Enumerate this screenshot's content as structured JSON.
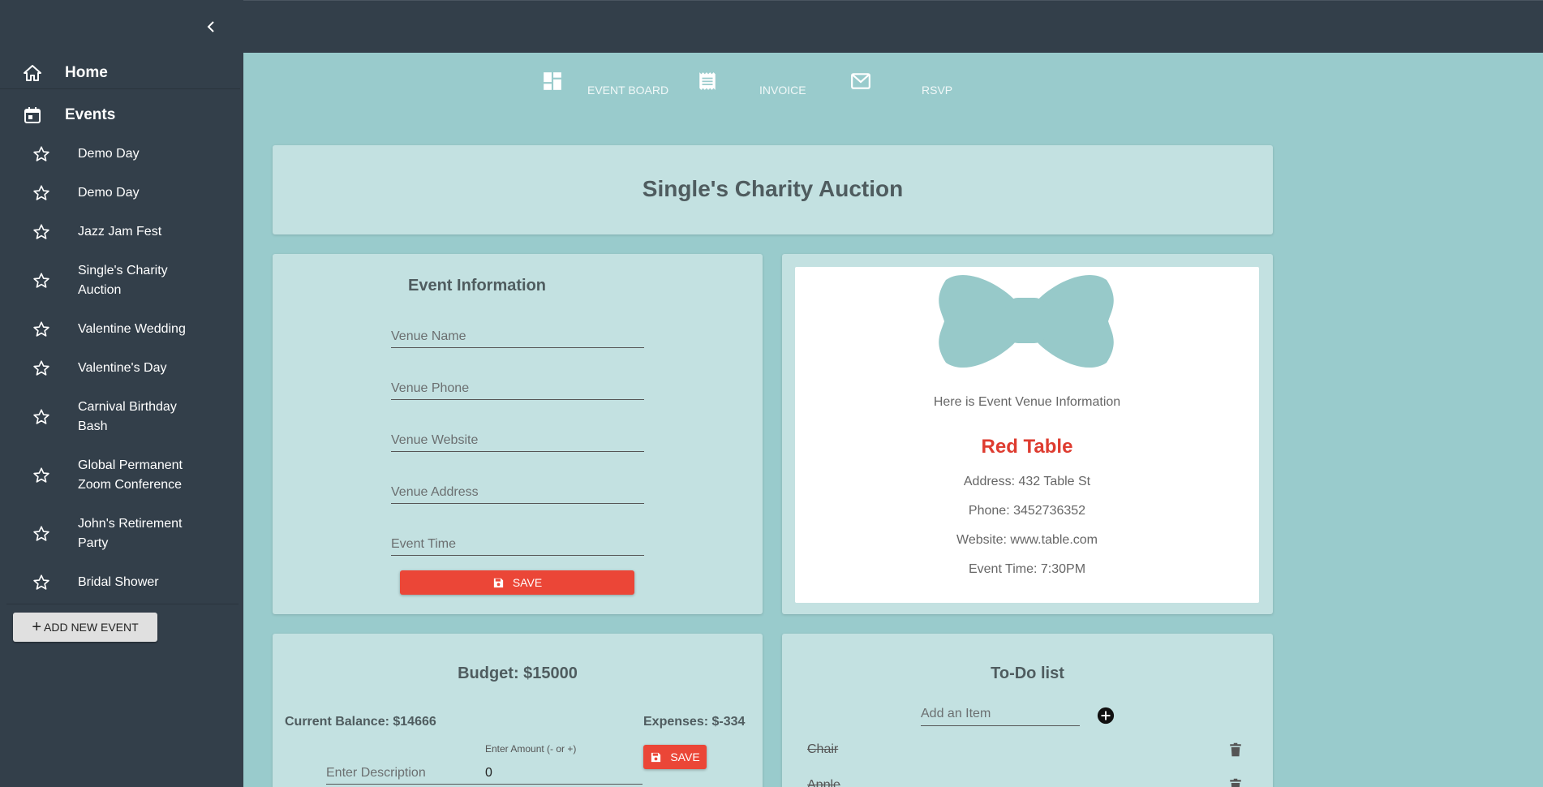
{
  "sidebar": {
    "home_label": "Home",
    "events_label": "Events",
    "events": [
      "Demo Day",
      "Demo Day",
      "Jazz Jam Fest",
      "Single's Charity Auction",
      "Valentine Wedding",
      "Valentine's Day",
      "Carnival Birthday Bash",
      "Global Permanent Zoom Conference",
      "John's Retirement Party",
      "Bridal Shower"
    ],
    "add_event_label": "ADD NEW EVENT"
  },
  "tabs": {
    "event_board": "EVENT BOARD",
    "invoice": "INVOICE",
    "rsvp": "RSVP"
  },
  "event_title": "Single's Charity Auction",
  "event_info": {
    "heading": "Event Information",
    "venue_name_placeholder": "Venue Name",
    "venue_phone_placeholder": "Venue Phone",
    "venue_website_placeholder": "Venue Website",
    "venue_address_placeholder": "Venue Address",
    "event_time_placeholder": "Event Time",
    "save_label": "SAVE"
  },
  "venue": {
    "intro": "Here is Event Venue Information",
    "name": "Red Table",
    "address": "Address: 432 Table St",
    "phone": "Phone: 3452736352",
    "website": "Website: www.table.com",
    "event_time": "Event Time: 7:30PM"
  },
  "budget": {
    "title": "Budget: $15000",
    "current_balance": "Current Balance: $14666",
    "expenses": "Expenses: $-334",
    "amount_label": "Enter Amount (- or +)",
    "description_placeholder": "Enter Description",
    "amount_value": "0",
    "save_label": "SAVE"
  },
  "todo": {
    "title": "To-Do list",
    "add_placeholder": "Add an Item",
    "items": [
      "Chair",
      "Apple"
    ]
  },
  "colors": {
    "sidebar": "#333F4A",
    "background": "#99CBCC",
    "card": "#C3E1E1",
    "save": "#EB4637",
    "venue_name": "#DE3C30"
  },
  "icons": {
    "collapse": "chevron-left-icon",
    "home": "home-icon",
    "events": "calendar-icon",
    "event_item": "star-outline-icon",
    "event_board": "dashboard-icon",
    "invoice": "receipt-icon",
    "rsvp": "mail-icon",
    "save": "floppy-disk-icon",
    "todo_add": "add-circle-icon",
    "todo_delete": "trash-icon",
    "venue": "bowtie-icon"
  }
}
